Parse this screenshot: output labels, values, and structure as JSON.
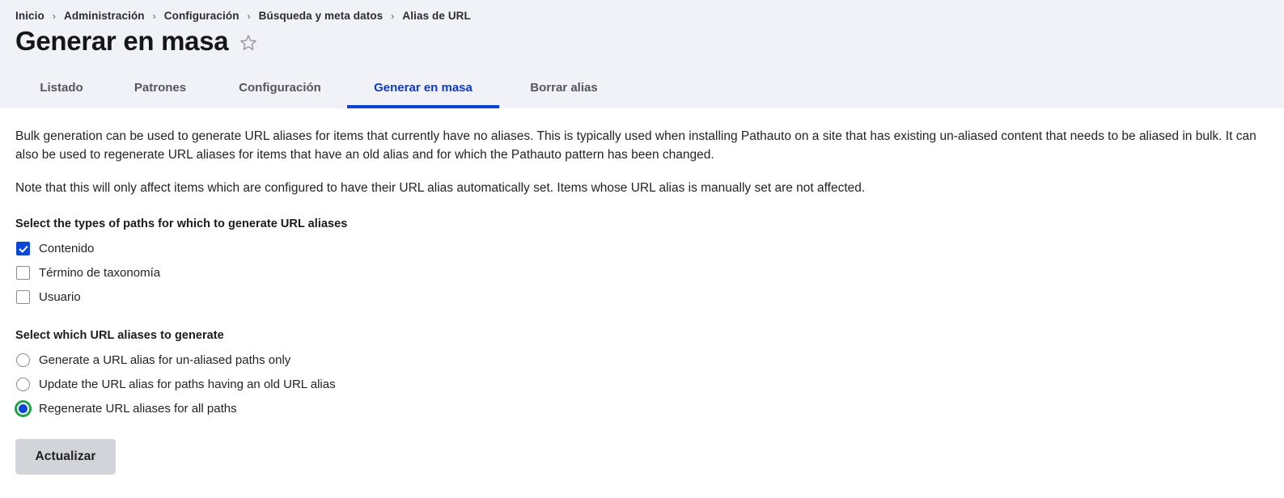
{
  "breadcrumb": {
    "separator": "›",
    "items": [
      {
        "label": "Inicio"
      },
      {
        "label": "Administración"
      },
      {
        "label": "Configuración"
      },
      {
        "label": "Búsqueda y meta datos"
      },
      {
        "label": "Alias de URL"
      }
    ]
  },
  "header": {
    "title": "Generar en masa",
    "star_icon": "star-outline-icon"
  },
  "tabs": {
    "items": [
      {
        "label": "Listado",
        "active": false
      },
      {
        "label": "Patrones",
        "active": false
      },
      {
        "label": "Configuración",
        "active": false
      },
      {
        "label": "Generar en masa",
        "active": true
      },
      {
        "label": "Borrar alias",
        "active": false
      }
    ]
  },
  "main": {
    "paragraph_1": "Bulk generation can be used to generate URL aliases for items that currently have no aliases. This is typically used when installing Pathauto on a site that has existing un-aliased content that needs to be aliased in bulk. It can also be used to regenerate URL aliases for items that have an old alias and for which the Pathauto pattern has been changed.",
    "paragraph_2": "Note that this will only affect items which are configured to have their URL alias automatically set. Items whose URL alias is manually set are not affected.",
    "path_types": {
      "legend": "Select the types of paths for which to generate URL aliases",
      "options": [
        {
          "label": "Contenido",
          "checked": true
        },
        {
          "label": "Término de taxonomía",
          "checked": false
        },
        {
          "label": "Usuario",
          "checked": false
        }
      ]
    },
    "alias_action": {
      "legend": "Select which URL aliases to generate",
      "options": [
        {
          "label": "Generate a URL alias for un-aliased paths only",
          "selected": false
        },
        {
          "label": "Update the URL alias for paths having an old URL alias",
          "selected": false
        },
        {
          "label": "Regenerate URL aliases for all paths",
          "selected": true
        }
      ]
    },
    "submit_label": "Actualizar"
  },
  "colors": {
    "header_bg": "#f1f2f7",
    "accent_blue": "#0d41d4",
    "active_tab_text": "#0d3bc7",
    "checkbox_checked": "#0c46d8",
    "radio_focus_ring": "#23a04b",
    "button_bg": "#d3d4d9"
  }
}
